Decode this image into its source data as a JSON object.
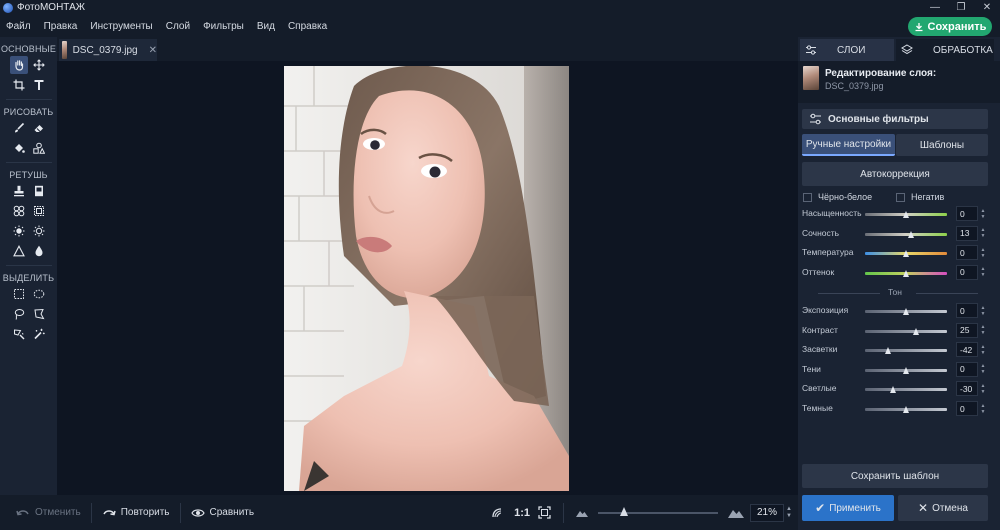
{
  "app": {
    "title": "ФотоМОНТАЖ",
    "window_controls": [
      "—",
      "❐",
      "✕"
    ]
  },
  "menu": [
    "Файл",
    "Правка",
    "Инструменты",
    "Слой",
    "Фильтры",
    "Вид",
    "Справка"
  ],
  "save_button": "Сохранить",
  "tools": {
    "groups": [
      {
        "title": "ОСНОВНЫЕ",
        "tools": [
          "hand-icon",
          "move-icon",
          "crop-icon",
          "text-icon"
        ]
      },
      {
        "title": "РИСОВАТЬ",
        "tools": [
          "brush-icon",
          "eraser-icon",
          "fill-icon",
          "shapes-icon"
        ]
      },
      {
        "title": "РЕТУШЬ",
        "tools": [
          "stamp-icon",
          "healing-icon",
          "pattern-icon",
          "frame-icon",
          "light-icon",
          "dark-icon",
          "sharpen-icon",
          "blur-icon"
        ]
      },
      {
        "title": "ВЫДЕЛИТЬ",
        "tools": [
          "rect-select-icon",
          "ellipse-select-icon",
          "lasso-icon",
          "polygon-lasso-icon",
          "magic-lasso-icon",
          "magic-wand-icon"
        ]
      }
    ]
  },
  "document_tab": {
    "name": "DSC_0379.jpg",
    "close": "✕"
  },
  "bottom_bar": {
    "undo": "Отменить",
    "redo": "Повторить",
    "compare": "Сравнить",
    "ratio": "1:1",
    "zoom": "21%",
    "zoom_level": 0.22
  },
  "right_panel": {
    "tabs": [
      "СЛОИ",
      "ОБРАБОТКА"
    ],
    "layer_title": "Редактирование слоя:",
    "layer_file": "DSC_0379.jpg",
    "basic_filters": "Основные фильтры",
    "subtabs": [
      "Ручные настройки",
      "Шаблоны"
    ],
    "autocorrection": "Автокоррекция",
    "checkbox_bw": "Чёрно-белое",
    "checkbox_negative": "Негатив",
    "tone_label": "Тон",
    "sliders_color": [
      {
        "label": "Насыщенность",
        "value": "0",
        "pos": 0.5
      },
      {
        "label": "Сочность",
        "value": "13",
        "pos": 0.565
      },
      {
        "label": "Температура",
        "value": "0",
        "pos": 0.5
      },
      {
        "label": "Оттенок",
        "value": "0",
        "pos": 0.5
      }
    ],
    "sliders_tone": [
      {
        "label": "Экспозиция",
        "value": "0",
        "pos": 0.5
      },
      {
        "label": "Контраст",
        "value": "25",
        "pos": 0.625
      },
      {
        "label": "Засветки",
        "value": "-42",
        "pos": 0.29
      },
      {
        "label": "Тени",
        "value": "0",
        "pos": 0.5
      },
      {
        "label": "Светлые",
        "value": "-30",
        "pos": 0.35
      },
      {
        "label": "Темные",
        "value": "0",
        "pos": 0.5
      }
    ],
    "save_template": "Сохранить шаблон",
    "apply": "Применить",
    "cancel": "Отмена"
  }
}
